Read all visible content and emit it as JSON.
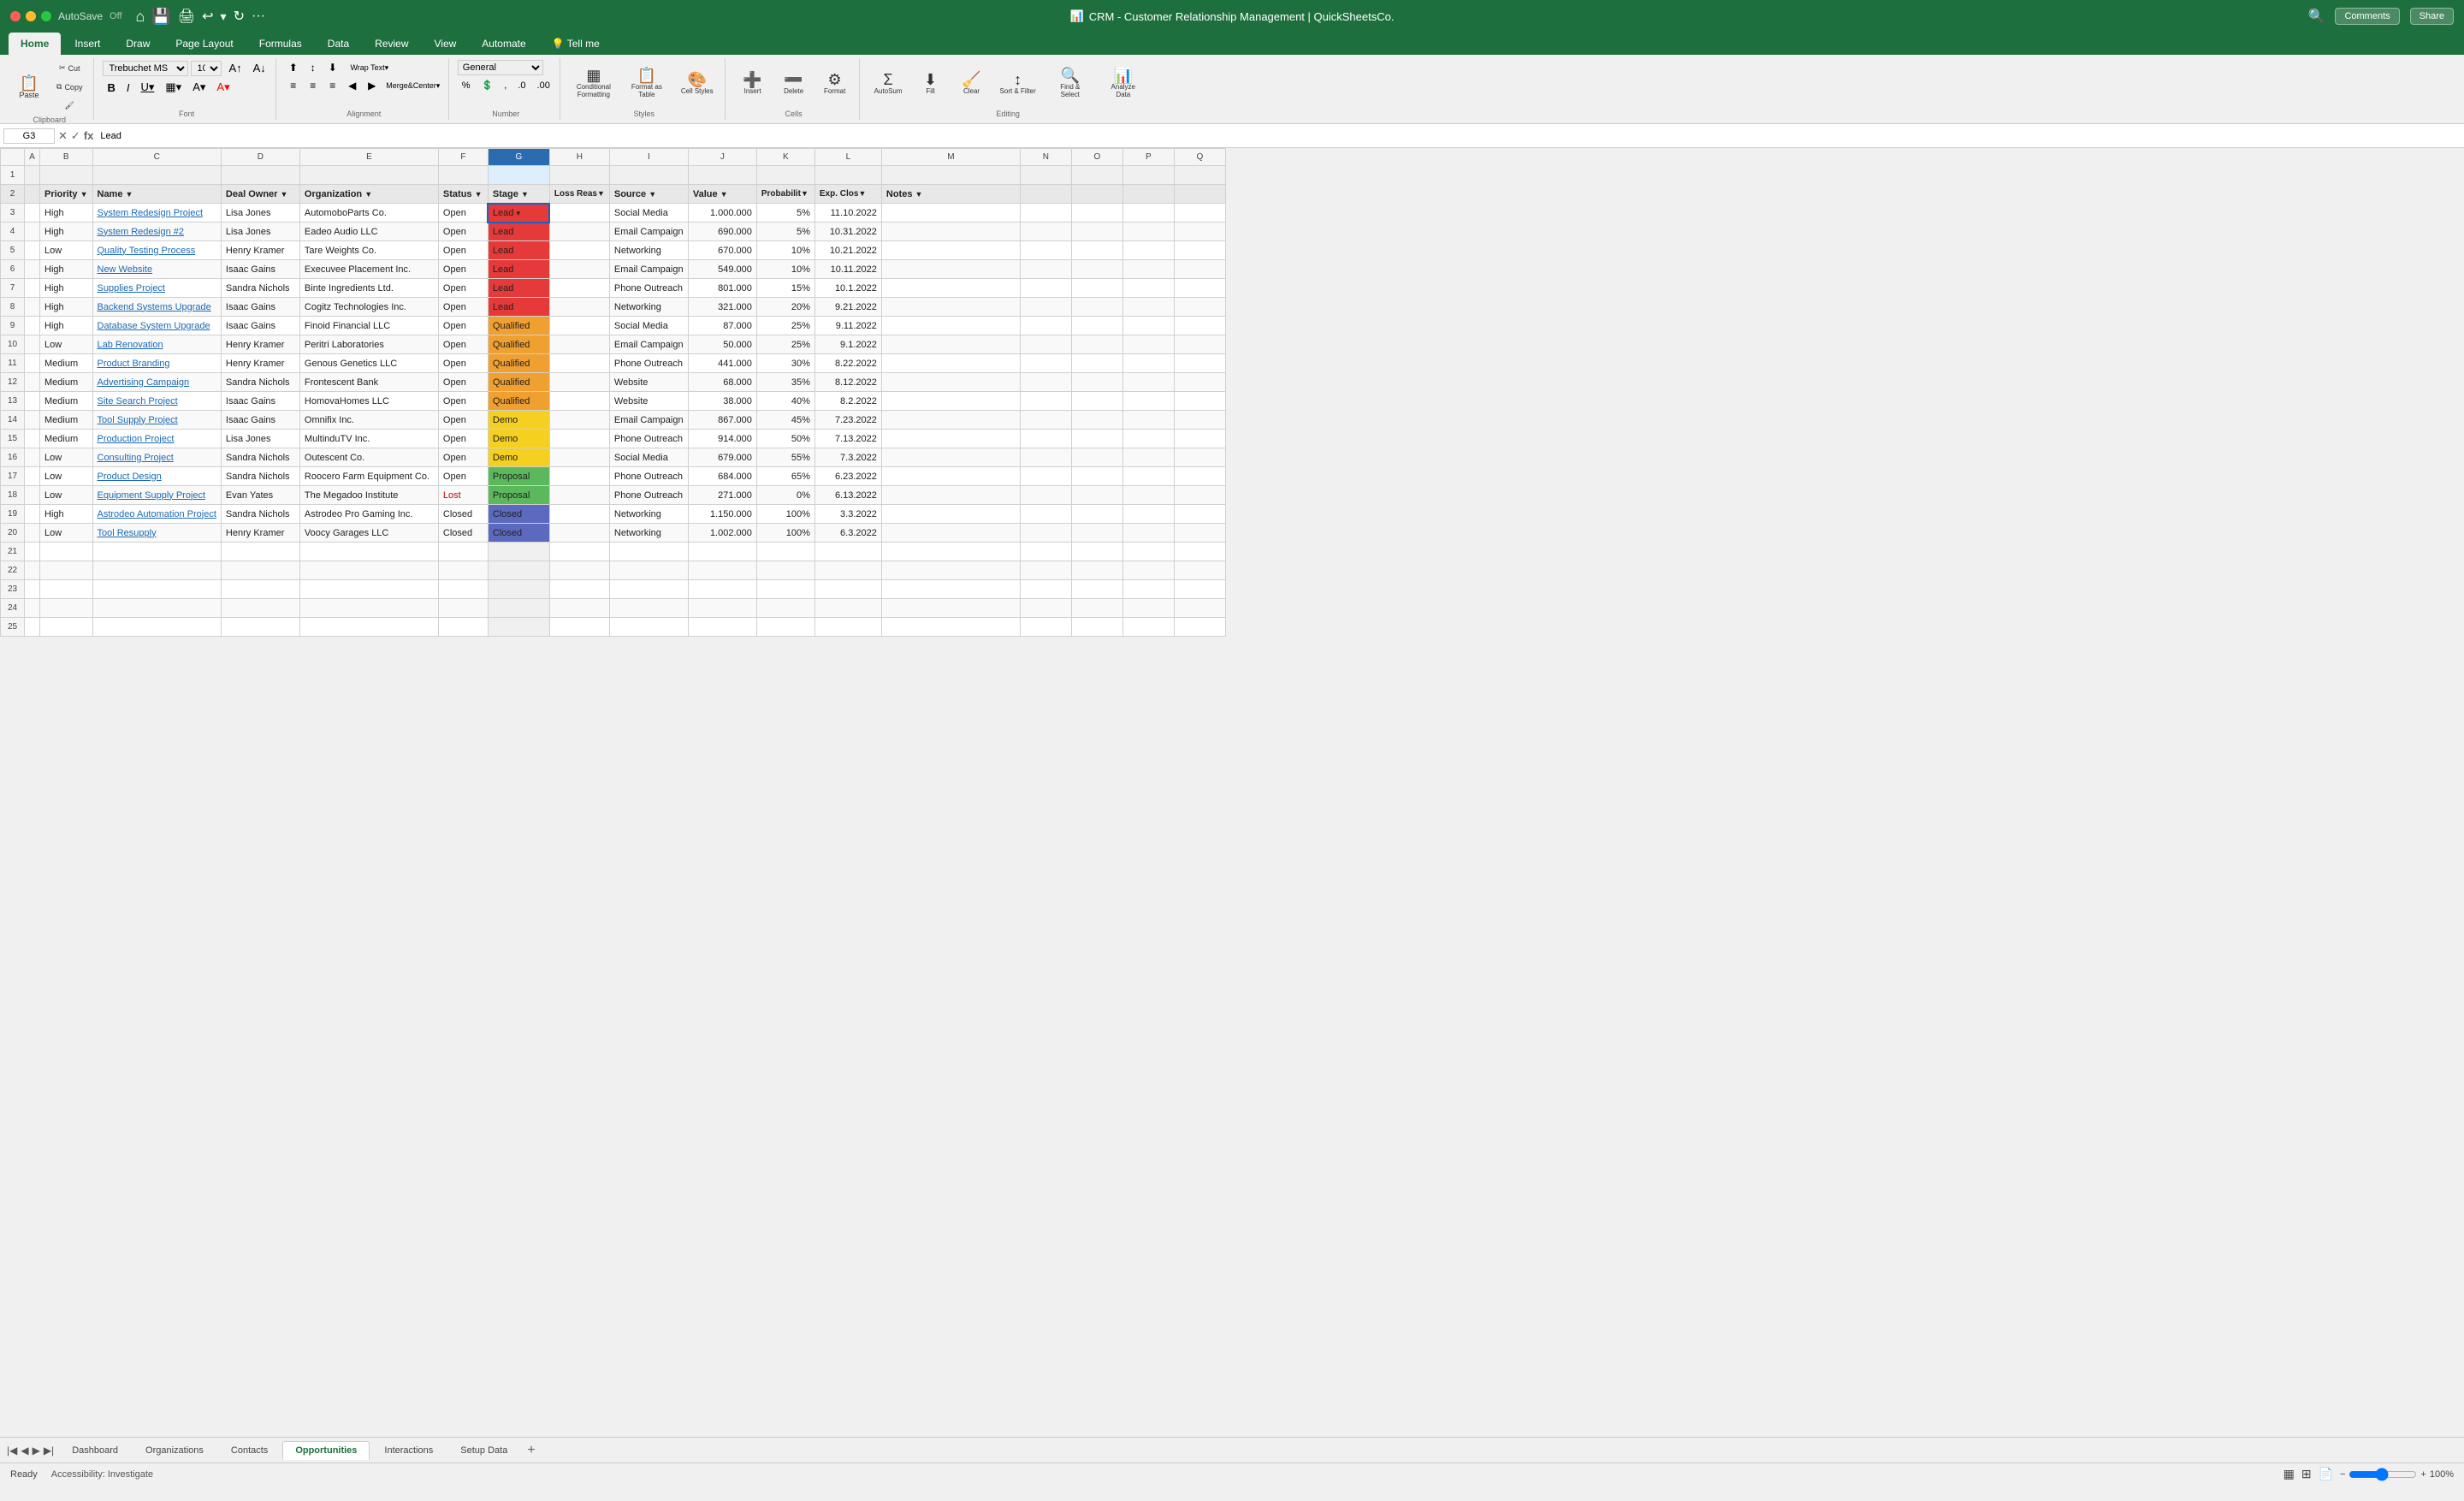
{
  "app": {
    "title": "CRM - Customer Relationship Management | QuickSheetsCo.",
    "autosave": "AutoSave",
    "autosave_state": "Off"
  },
  "ribbon_tabs": [
    "Home",
    "Insert",
    "Draw",
    "Page Layout",
    "Formulas",
    "Data",
    "Review",
    "View",
    "Automate",
    "Tell me"
  ],
  "active_tab": "Home",
  "toolbar": {
    "font_family": "Trebuchet MS",
    "font_size": "10",
    "paste_label": "Paste",
    "wrap_text_label": "Wrap Text",
    "merge_center_label": "Merge & Center",
    "number_format": "General",
    "conditional_format_label": "Conditional Formatting",
    "format_as_table_label": "Format as Table",
    "cell_styles_label": "Cell Styles",
    "insert_label": "Insert",
    "delete_label": "Delete",
    "format_label": "Format",
    "sort_filter_label": "Sort & Filter",
    "find_select_label": "Find & Select",
    "analyze_label": "Analyze Data"
  },
  "formula_bar": {
    "cell_ref": "G3",
    "formula": "Lead"
  },
  "columns": [
    {
      "id": "row_header",
      "label": "",
      "width": 28
    },
    {
      "id": "A",
      "label": "A",
      "width": 18
    },
    {
      "id": "B",
      "label": "B",
      "width": 52
    },
    {
      "id": "C",
      "label": "C",
      "width": 140
    },
    {
      "id": "D",
      "label": "D",
      "width": 90
    },
    {
      "id": "E",
      "label": "E",
      "width": 160
    },
    {
      "id": "F",
      "label": "F",
      "width": 58
    },
    {
      "id": "G",
      "label": "G",
      "width": 72
    },
    {
      "id": "H",
      "label": "H",
      "width": 90
    },
    {
      "id": "I",
      "label": "I",
      "width": 90
    },
    {
      "id": "J",
      "label": "J",
      "width": 78
    },
    {
      "id": "K",
      "label": "K",
      "width": 68
    },
    {
      "id": "L",
      "label": "L",
      "width": 78
    },
    {
      "id": "M",
      "label": "M",
      "width": 160
    },
    {
      "id": "N",
      "label": "N",
      "width": 60
    },
    {
      "id": "O",
      "label": "O",
      "width": 60
    },
    {
      "id": "P",
      "label": "P",
      "width": 60
    },
    {
      "id": "Q",
      "label": "Q",
      "width": 60
    }
  ],
  "header_row": {
    "row": 2,
    "cells": [
      "Priority",
      "Name",
      "Deal Owner",
      "Organization",
      "Status",
      "Stage",
      "Loss Reason",
      "Source",
      "Value",
      "Probability",
      "Exp. Close",
      "Notes"
    ]
  },
  "data_rows": [
    {
      "row": 3,
      "priority": "High",
      "name": "System Redesign Project",
      "owner": "Lisa Jones",
      "org": "AutomoboParts Co.",
      "status": "Open",
      "stage": "Lead",
      "stage_class": "stage-lead",
      "loss_reason": "",
      "source": "Social Media",
      "value": "1.000.000",
      "probability": "5%",
      "exp_close": "11.10.2022",
      "notes": ""
    },
    {
      "row": 4,
      "priority": "High",
      "name": "System Redesign #2",
      "owner": "Lisa Jones",
      "org": "Eadeo Audio LLC",
      "status": "Open",
      "stage": "Lead",
      "stage_class": "stage-lead",
      "loss_reason": "",
      "source": "Email Campaign",
      "value": "690.000",
      "probability": "5%",
      "exp_close": "10.31.2022",
      "notes": ""
    },
    {
      "row": 5,
      "priority": "Low",
      "name": "Quality Testing Process",
      "owner": "Henry Kramer",
      "org": "Tare Weights Co.",
      "status": "Open",
      "stage": "Lead",
      "stage_class": "stage-lead",
      "loss_reason": "",
      "source": "Networking",
      "value": "670.000",
      "probability": "10%",
      "exp_close": "10.21.2022",
      "notes": ""
    },
    {
      "row": 6,
      "priority": "High",
      "name": "New Website",
      "owner": "Isaac Gains",
      "org": "Execuvee Placement Inc.",
      "status": "Open",
      "stage": "Lead",
      "stage_class": "stage-lead",
      "loss_reason": "",
      "source": "Email Campaign",
      "value": "549.000",
      "probability": "10%",
      "exp_close": "10.11.2022",
      "notes": ""
    },
    {
      "row": 7,
      "priority": "High",
      "name": "Supplies Project",
      "owner": "Sandra Nichols",
      "org": "Binte Ingredients Ltd.",
      "status": "Open",
      "stage": "Lead",
      "stage_class": "stage-lead",
      "loss_reason": "",
      "source": "Phone Outreach",
      "value": "801.000",
      "probability": "15%",
      "exp_close": "10.1.2022",
      "notes": ""
    },
    {
      "row": 8,
      "priority": "High",
      "name": "Backend Systems Upgrade",
      "owner": "Isaac Gains",
      "org": "Cogitz Technologies Inc.",
      "status": "Open",
      "stage": "Lead",
      "stage_class": "stage-lead",
      "loss_reason": "",
      "source": "Networking",
      "value": "321.000",
      "probability": "20%",
      "exp_close": "9.21.2022",
      "notes": ""
    },
    {
      "row": 9,
      "priority": "High",
      "name": "Database System Upgrade",
      "owner": "Isaac Gains",
      "org": "Finoid Financial LLC",
      "status": "Open",
      "stage": "Qualified",
      "stage_class": "stage-qualified",
      "loss_reason": "",
      "source": "Social Media",
      "value": "87.000",
      "probability": "25%",
      "exp_close": "9.11.2022",
      "notes": ""
    },
    {
      "row": 10,
      "priority": "Low",
      "name": "Lab Renovation",
      "owner": "Henry Kramer",
      "org": "Peritri Laboratories",
      "status": "Open",
      "stage": "Qualified",
      "stage_class": "stage-qualified",
      "loss_reason": "",
      "source": "Email Campaign",
      "value": "50.000",
      "probability": "25%",
      "exp_close": "9.1.2022",
      "notes": ""
    },
    {
      "row": 11,
      "priority": "Medium",
      "name": "Product Branding",
      "owner": "Henry Kramer",
      "org": "Genous Genetics LLC",
      "status": "Open",
      "stage": "Qualified",
      "stage_class": "stage-qualified",
      "loss_reason": "",
      "source": "Phone Outreach",
      "value": "441.000",
      "probability": "30%",
      "exp_close": "8.22.2022",
      "notes": ""
    },
    {
      "row": 12,
      "priority": "Medium",
      "name": "Advertising Campaign",
      "owner": "Sandra Nichols",
      "org": "Frontescent Bank",
      "status": "Open",
      "stage": "Qualified",
      "stage_class": "stage-qualified",
      "loss_reason": "",
      "source": "Website",
      "value": "68.000",
      "probability": "35%",
      "exp_close": "8.12.2022",
      "notes": ""
    },
    {
      "row": 13,
      "priority": "Medium",
      "name": "Site Search Project",
      "owner": "Isaac Gains",
      "org": "HomovaHomes LLC",
      "status": "Open",
      "stage": "Qualified",
      "stage_class": "stage-qualified",
      "loss_reason": "",
      "source": "Website",
      "value": "38.000",
      "probability": "40%",
      "exp_close": "8.2.2022",
      "notes": ""
    },
    {
      "row": 14,
      "priority": "Medium",
      "name": "Tool Supply Project",
      "owner": "Isaac Gains",
      "org": "Omnifix Inc.",
      "status": "Open",
      "stage": "Demo",
      "stage_class": "stage-demo",
      "loss_reason": "",
      "source": "Email Campaign",
      "value": "867.000",
      "probability": "45%",
      "exp_close": "7.23.2022",
      "notes": ""
    },
    {
      "row": 15,
      "priority": "Medium",
      "name": "Production Project",
      "owner": "Lisa Jones",
      "org": "MultinduTV Inc.",
      "status": "Open",
      "stage": "Demo",
      "stage_class": "stage-demo",
      "loss_reason": "",
      "source": "Phone Outreach",
      "value": "914.000",
      "probability": "50%",
      "exp_close": "7.13.2022",
      "notes": ""
    },
    {
      "row": 16,
      "priority": "Low",
      "name": "Consulting Project",
      "owner": "Sandra Nichols",
      "org": "Outescent Co.",
      "status": "Open",
      "stage": "Demo",
      "stage_class": "stage-demo",
      "loss_reason": "",
      "source": "Social Media",
      "value": "679.000",
      "probability": "55%",
      "exp_close": "7.3.2022",
      "notes": ""
    },
    {
      "row": 17,
      "priority": "Low",
      "name": "Product Design",
      "owner": "Sandra Nichols",
      "org": "Roocero Farm Equipment Co.",
      "status": "Open",
      "stage": "Proposal",
      "stage_class": "stage-proposal",
      "loss_reason": "",
      "source": "Phone Outreach",
      "value": "684.000",
      "probability": "65%",
      "exp_close": "6.23.2022",
      "notes": ""
    },
    {
      "row": 18,
      "priority": "Low",
      "name": "Equipment Supply Project",
      "owner": "Evan Yates",
      "org": "The Megadoo Institute",
      "status": "Lost",
      "stage": "Proposal",
      "stage_class": "stage-proposal",
      "loss_reason": "",
      "source": "Phone Outreach",
      "value": "271.000",
      "probability": "0%",
      "exp_close": "6.13.2022",
      "notes": ""
    },
    {
      "row": 19,
      "priority": "High",
      "name": "Astrodeo Automation Project",
      "owner": "Sandra Nichols",
      "org": "Astrodeo Pro Gaming Inc.",
      "status": "Closed",
      "stage": "Closed",
      "stage_class": "stage-closed",
      "loss_reason": "",
      "source": "Networking",
      "value": "1.150.000",
      "probability": "100%",
      "exp_close": "3.3.2022",
      "notes": ""
    },
    {
      "row": 20,
      "priority": "Low",
      "name": "Tool Resupply",
      "owner": "Henry Kramer",
      "org": "Voocy Garages LLC",
      "status": "Closed",
      "stage": "Closed",
      "stage_class": "stage-closed",
      "loss_reason": "",
      "source": "Networking",
      "value": "1.002.000",
      "probability": "100%",
      "exp_close": "6.3.2022",
      "notes": ""
    },
    {
      "row": 21,
      "priority": "",
      "name": "",
      "owner": "",
      "org": "",
      "status": "",
      "stage": "",
      "stage_class": "",
      "loss_reason": "",
      "source": "",
      "value": "",
      "probability": "",
      "exp_close": "",
      "notes": ""
    },
    {
      "row": 22,
      "priority": "",
      "name": "",
      "owner": "",
      "org": "",
      "status": "",
      "stage": "",
      "stage_class": "",
      "loss_reason": "",
      "source": "",
      "value": "",
      "probability": "",
      "exp_close": "",
      "notes": ""
    },
    {
      "row": 23,
      "priority": "",
      "name": "",
      "owner": "",
      "org": "",
      "status": "",
      "stage": "",
      "stage_class": "",
      "loss_reason": "",
      "source": "",
      "value": "",
      "probability": "",
      "exp_close": "",
      "notes": ""
    },
    {
      "row": 24,
      "priority": "",
      "name": "",
      "owner": "",
      "org": "",
      "status": "",
      "stage": "",
      "stage_class": "",
      "loss_reason": "",
      "source": "",
      "value": "",
      "probability": "",
      "exp_close": "",
      "notes": ""
    },
    {
      "row": 25,
      "priority": "",
      "name": "",
      "owner": "",
      "org": "",
      "status": "",
      "stage": "",
      "stage_class": "",
      "loss_reason": "",
      "source": "",
      "value": "",
      "probability": "",
      "exp_close": "",
      "notes": ""
    }
  ],
  "sheet_tabs": [
    "Dashboard",
    "Organizations",
    "Contacts",
    "Opportunities",
    "Interactions",
    "Setup Data"
  ],
  "active_sheet": "Opportunities",
  "status_bar": {
    "ready": "Ready",
    "accessibility": "Accessibility: Investigate",
    "zoom": "100%"
  },
  "comments_btn": "Comments",
  "share_btn": "Share"
}
